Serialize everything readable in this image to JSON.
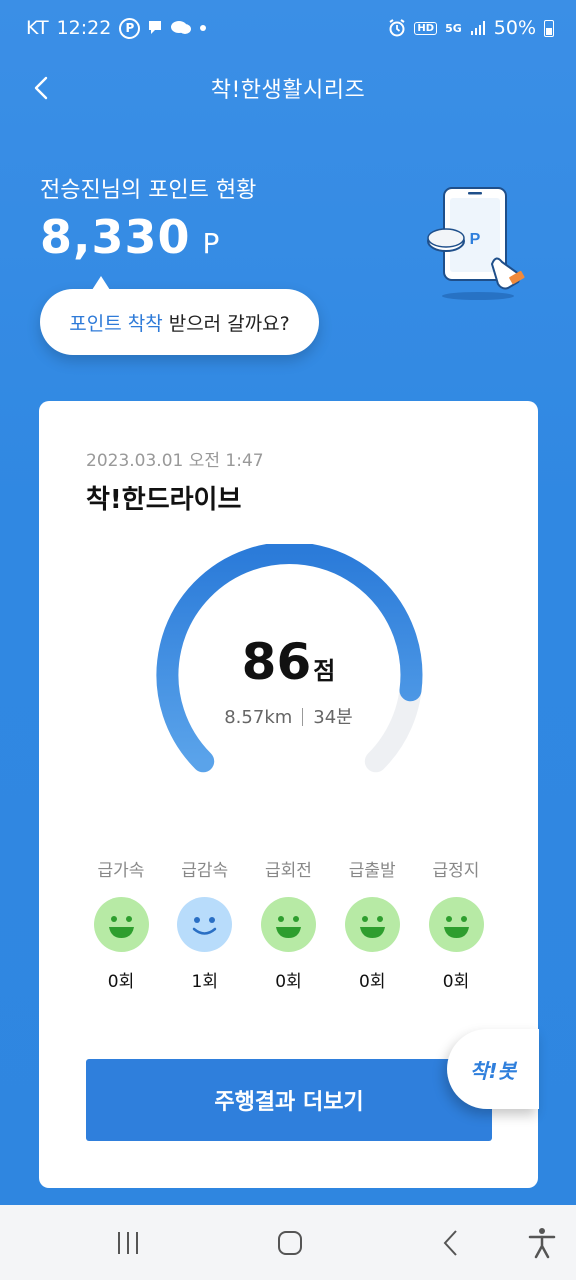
{
  "status_bar": {
    "carrier": "KT",
    "time": "12:22",
    "network": "5G",
    "battery": "50%"
  },
  "header": {
    "title": "착!한생활시리즈"
  },
  "points": {
    "label": "전승진님의 포인트 현황",
    "value": "8,330",
    "unit": "P"
  },
  "bubble": {
    "accent": "포인트 착착",
    "text": "받으러 갈까요?"
  },
  "card": {
    "date": "2023.03.01 오전 1:47",
    "title": "착!한드라이브",
    "score": "86",
    "score_unit": "점",
    "score_fraction": 0.86,
    "distance": "8.57km",
    "duration": "34분",
    "events": [
      {
        "label": "급가속",
        "count": "0회",
        "face": "green"
      },
      {
        "label": "급감속",
        "count": "1회",
        "face": "blue"
      },
      {
        "label": "급회전",
        "count": "0회",
        "face": "green"
      },
      {
        "label": "급출발",
        "count": "0회",
        "face": "green"
      },
      {
        "label": "급정지",
        "count": "0회",
        "face": "green"
      }
    ],
    "more_button": "주행결과 더보기"
  },
  "floating_bot": "착!봇",
  "icons": [
    "back-arrow-icon",
    "recent-apps-icon",
    "home-icon",
    "nav-back-icon",
    "accessibility-icon"
  ],
  "colors": {
    "accent": "#2f7fdc",
    "background": "#3088e2",
    "face_green": "#b7eaa5",
    "face_blue": "#b8dcfb"
  }
}
